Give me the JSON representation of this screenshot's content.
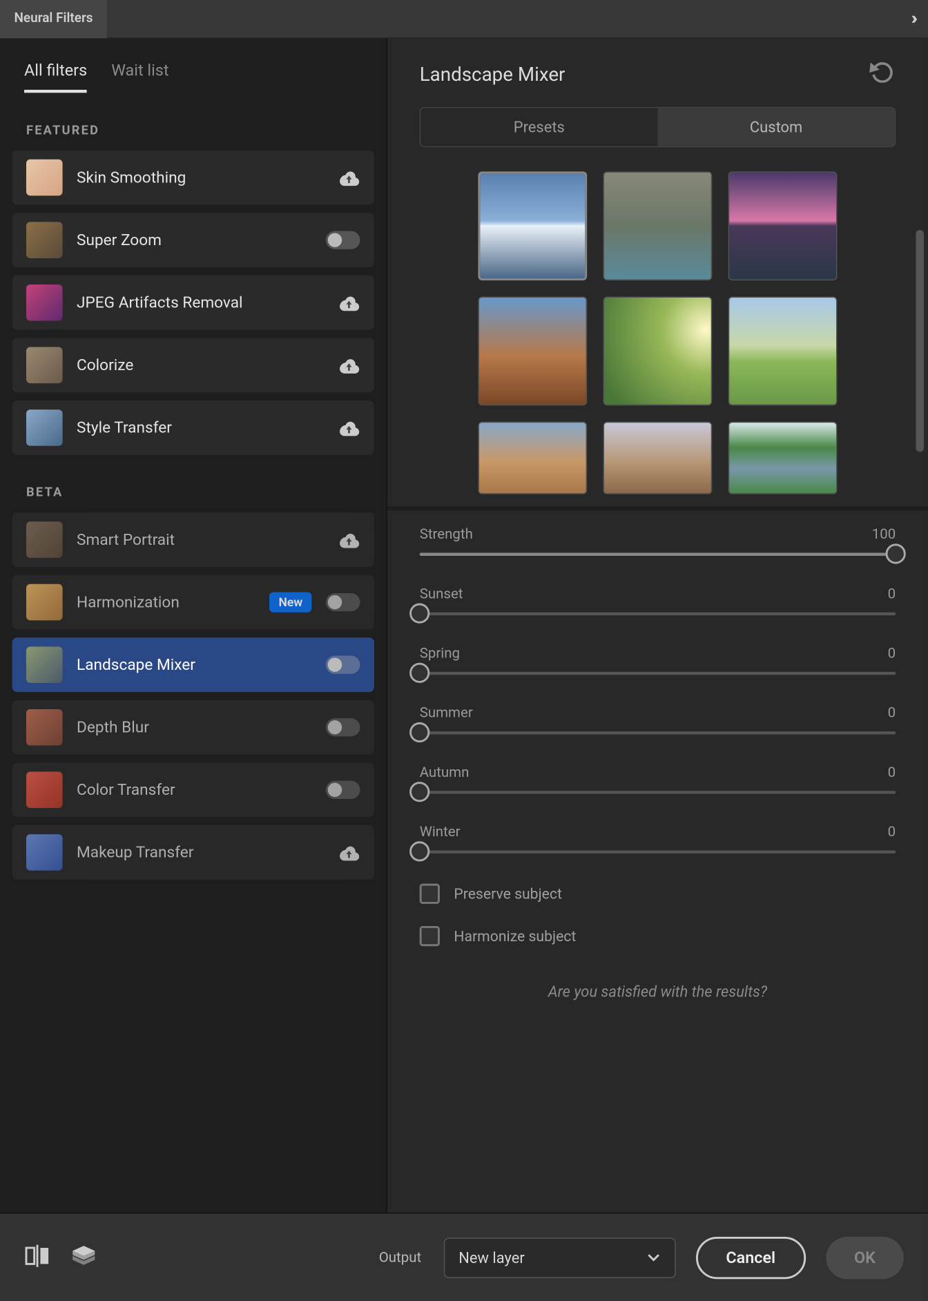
{
  "panel_tab": "Neural Filters",
  "tabs": {
    "all": "All filters",
    "wait": "Wait list"
  },
  "sections": {
    "featured": "FEATURED",
    "beta": "BETA"
  },
  "filters": {
    "featured": [
      {
        "label": "Skin Smoothing",
        "control": "cloud"
      },
      {
        "label": "Super Zoom",
        "control": "toggle"
      },
      {
        "label": "JPEG Artifacts Removal",
        "control": "cloud"
      },
      {
        "label": "Colorize",
        "control": "cloud"
      },
      {
        "label": "Style Transfer",
        "control": "cloud"
      }
    ],
    "beta": [
      {
        "label": "Smart Portrait",
        "control": "cloud"
      },
      {
        "label": "Harmonization",
        "control": "toggle",
        "badge": "New"
      },
      {
        "label": "Landscape Mixer",
        "control": "toggle",
        "selected": true
      },
      {
        "label": "Depth Blur",
        "control": "toggle"
      },
      {
        "label": "Color Transfer",
        "control": "toggle"
      },
      {
        "label": "Makeup Transfer",
        "control": "cloud"
      }
    ]
  },
  "content": {
    "title": "Landscape Mixer",
    "segments": {
      "presets": "Presets",
      "custom": "Custom",
      "active": "custom"
    },
    "sliders": [
      {
        "label": "Strength",
        "value": 100
      },
      {
        "label": "Sunset",
        "value": 0
      },
      {
        "label": "Spring",
        "value": 0
      },
      {
        "label": "Summer",
        "value": 0
      },
      {
        "label": "Autumn",
        "value": 0
      },
      {
        "label": "Winter",
        "value": 0
      }
    ],
    "checkboxes": [
      {
        "label": "Preserve subject"
      },
      {
        "label": "Harmonize subject"
      }
    ],
    "survey": "Are you satisfied with the results?"
  },
  "footer": {
    "output_label": "Output",
    "output_value": "New layer",
    "cancel": "Cancel",
    "ok": "OK"
  }
}
